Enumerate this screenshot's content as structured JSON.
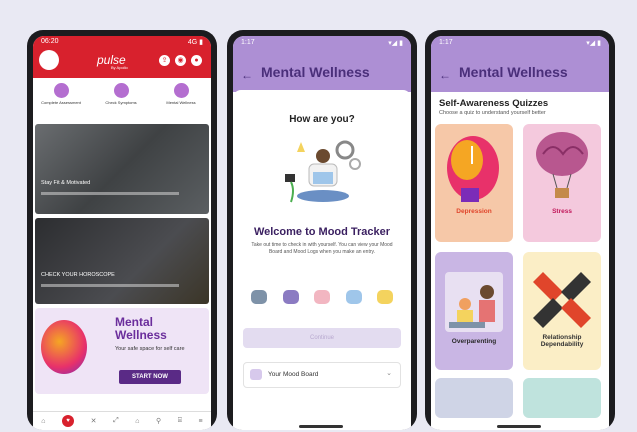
{
  "phone1": {
    "status_time": "06:20",
    "status_right": "4G ▮",
    "brand": "pulse",
    "brand_tag": "By Apollo",
    "quick_links": [
      "Complete Assessment",
      "Check Symptoms",
      "Mental Wellness"
    ],
    "cards": [
      {
        "title": "Stay Fit & Motivated"
      },
      {
        "title": "CHECK YOUR HOROSCOPE"
      }
    ],
    "promo": {
      "title_line1": "Mental",
      "title_line2": "Wellness",
      "subtitle": "Your safe space for self care",
      "button": "START NOW"
    },
    "nav": [
      "⌂",
      "♥",
      "✕",
      "⤢",
      "⌂",
      "⚲",
      "⌸",
      "≡"
    ]
  },
  "phone2": {
    "status_time": "1:17",
    "status_right": "▾◢ ▮",
    "back": "←",
    "title": "Mental Wellness",
    "question": "How are you?",
    "welcome": "Welcome to Mood Tracker",
    "description": "Take out time to check in with yourself. You can view your Mood Board and Mood Logs when you make an entry.",
    "moods": [
      "#7e92a8",
      "#8b7bc2",
      "#f2b6c1",
      "#9fc6ea",
      "#f4d35e"
    ],
    "continue": "Continue",
    "mood_board": "Your Mood Board",
    "chevron": "⌄"
  },
  "phone3": {
    "status_time": "1:17",
    "status_right": "▾◢ ▮",
    "back": "←",
    "title": "Mental Wellness",
    "section_title": "Self-Awareness Quizzes",
    "section_sub": "Choose a quiz to understand yourself better",
    "quizzes": [
      {
        "label": "Depression",
        "bg": "#f6c8a8",
        "color": "#e0452b"
      },
      {
        "label": "Stress",
        "bg": "#f4c9dd",
        "color": "#c2185b"
      },
      {
        "label": "Overparenting",
        "bg": "#c9b6e4",
        "color": "#2a2a2a"
      },
      {
        "label": "Relationship Dependability",
        "bg": "#fbeec6",
        "color": "#333"
      }
    ]
  },
  "colors": {
    "brand_red": "#d8212d",
    "purple": "#6b2e9c",
    "lavender": "#ad8fd4"
  }
}
